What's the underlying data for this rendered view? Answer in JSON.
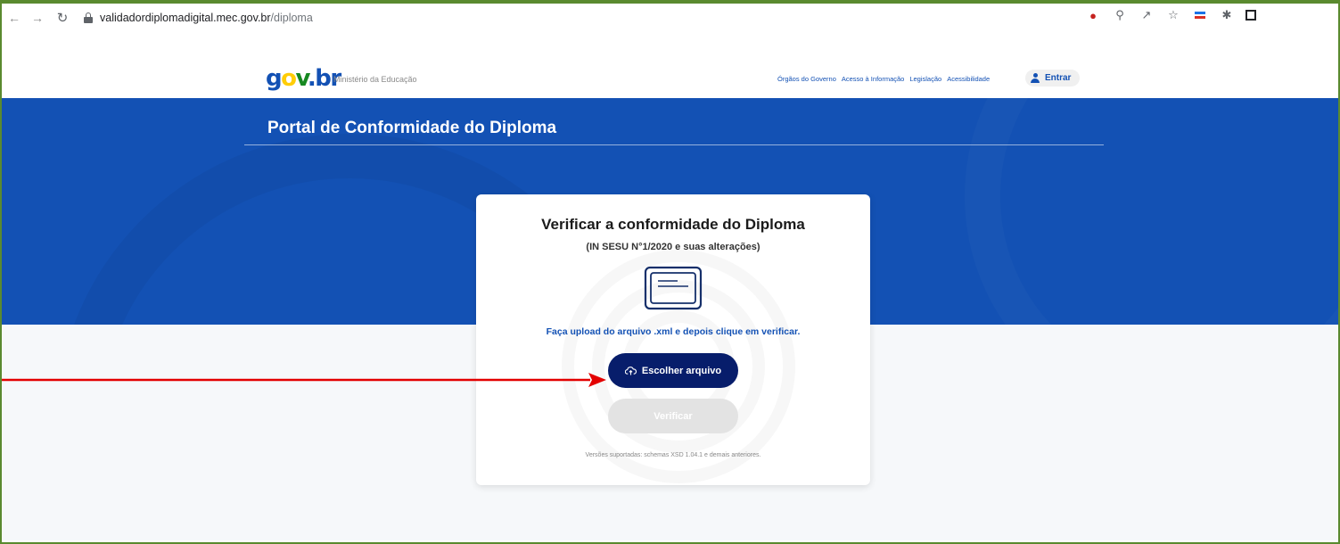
{
  "browser": {
    "url_host": "validadordiplomadigital.mec.gov.br",
    "url_path": "/diploma",
    "icons": [
      "back-icon",
      "forward-icon",
      "reload-icon",
      "lock-icon",
      "extension-icon",
      "zoom-icon",
      "share-icon",
      "bookmark-star-icon",
      "flag-icon",
      "puzzle-icon",
      "side-panel-icon"
    ]
  },
  "header": {
    "logo_parts": [
      "g",
      "o",
      "v",
      ".",
      "b",
      "r"
    ],
    "ministry": "Ministério da Educação",
    "links": [
      "Órgãos do Governo",
      "Acesso à Informação",
      "Legislação",
      "Acessibilidade"
    ],
    "login_label": "Entrar"
  },
  "hero": {
    "title": "Portal de Conformidade do Diploma"
  },
  "card": {
    "title": "Verificar a conformidade do Diploma",
    "subtitle": "(IN SESU N°1/2020 e suas alterações)",
    "instruction": "Faça upload do arquivo .xml e depois clique em verificar.",
    "choose_button": "Escolher arquivo",
    "verify_button": "Verificar",
    "verify_enabled": false,
    "footnote": "Versões suportadas: schemas XSD 1.04.1 e demais anteriores."
  },
  "colors": {
    "gov_blue": "#1351b4",
    "navy_button": "#071d6b",
    "annotation_red": "#e30000",
    "frame_green": "#5a8a2f"
  }
}
